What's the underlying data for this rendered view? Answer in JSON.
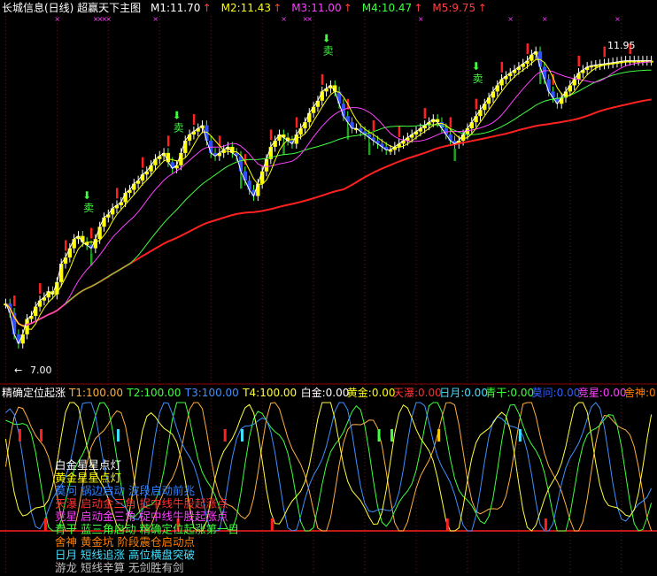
{
  "header": {
    "title": "长城信息(日线) 超赢天下主图",
    "title_color": "#ffffff",
    "indicators": [
      {
        "label": "M1:11.70",
        "color": "#ffffff"
      },
      {
        "label": "M2:11.43",
        "color": "#ffff00"
      },
      {
        "label": "M3:11.00",
        "color": "#ff40ff"
      },
      {
        "label": "M4:10.47",
        "color": "#40ff40"
      },
      {
        "label": "M5:9.75",
        "color": "#ff4040"
      }
    ]
  },
  "sub_header": {
    "title": "精确定位起涨",
    "items": [
      {
        "label": "T1:100.00",
        "color": "#ffb040"
      },
      {
        "label": "T2:100.00",
        "color": "#40ff40"
      },
      {
        "label": "T3:100.00",
        "color": "#4090ff"
      },
      {
        "label": "T4:100.00",
        "color": "#ffff40"
      },
      {
        "label": "白金:0.00",
        "color": "#ffffff"
      },
      {
        "label": "黄金:0.00",
        "color": "#ffff00"
      },
      {
        "label": "天瀑:0.00",
        "color": "#ff3030"
      },
      {
        "label": "日月:0.00",
        "color": "#40e0ff"
      },
      {
        "label": "青干:0.00",
        "color": "#40ff40"
      },
      {
        "label": "莫问:0.00",
        "color": "#3060ff"
      },
      {
        "label": "竞星:0.00",
        "color": "#ff40ff"
      },
      {
        "label": "舍神:0",
        "color": "#ff8000"
      }
    ]
  },
  "legend_lines": [
    {
      "text": "白金星星点灯",
      "color": "#ffffff"
    },
    {
      "text": "黄金星星点灯",
      "color": "#ffff00"
    },
    {
      "text": "莫问  锅边启动  波段启动前兆",
      "color": "#3080ff"
    },
    {
      "text": "天瀑  启动金三角  捉中线牛股起涨点",
      "color": "#ff3030"
    },
    {
      "text": "竞星  启动金三角  捉中线牛股起涨点",
      "color": "#ff40ff"
    },
    {
      "text": "青干  蓝三角启动  精确定位起涨第一目",
      "color": "#40ff40"
    },
    {
      "text": "舍神  黄金坑  阶段震仓启动点",
      "color": "#ff8000"
    },
    {
      "text": "日月  短线追涨  高位横盘突破",
      "color": "#40e0ff"
    },
    {
      "text": "游龙  短线辛算  无剑胜有剑",
      "color": "#c0c0c0"
    }
  ],
  "annotations": {
    "high_label": "11.95",
    "low_label": "7.00",
    "sell_label": "卖",
    "sell_color": "#40ff40",
    "arrow_color": "#ffffff"
  },
  "chart_data": [
    {
      "type": "line",
      "title": "长城信息(日线) 超赢天下主图",
      "ylim": [
        6.6,
        12.5
      ],
      "price_high": 11.95,
      "price_low": 7.0,
      "x": [
        0,
        1,
        2,
        3,
        4,
        5,
        6,
        7,
        8,
        9,
        10,
        11,
        12,
        13,
        14,
        15,
        16,
        17,
        18,
        19,
        20,
        21,
        22,
        23,
        24,
        25,
        26,
        27,
        28,
        29,
        30,
        31,
        32,
        33,
        34,
        35,
        36,
        37,
        38,
        39,
        40,
        41,
        42,
        43,
        44,
        45,
        46,
        47,
        48,
        49,
        50,
        51,
        52,
        53,
        54,
        55,
        56,
        57,
        58,
        59,
        60,
        61,
        62,
        63,
        64,
        65,
        66,
        67,
        68,
        69,
        70,
        71,
        72,
        73,
        74,
        75,
        76,
        77,
        78,
        79,
        80,
        81,
        82,
        83,
        84,
        85,
        86,
        87,
        88,
        89,
        90,
        91,
        92,
        93,
        94,
        95,
        96,
        97,
        98,
        99,
        100,
        101,
        102,
        103,
        104,
        105,
        106,
        107,
        108,
        109,
        110,
        111,
        112,
        113,
        114,
        115,
        116,
        117,
        118,
        119,
        120,
        121,
        122,
        123,
        124,
        125,
        126,
        127,
        128,
        129,
        130,
        131,
        132,
        133,
        134,
        135,
        136,
        137,
        138,
        139,
        140,
        141,
        142,
        143,
        144,
        145,
        146,
        147,
        148,
        149
      ],
      "close": [
        7.85,
        7.7,
        7.35,
        7.2,
        7.35,
        7.6,
        7.65,
        7.8,
        7.9,
        7.95,
        8.05,
        8.0,
        8.2,
        8.5,
        8.6,
        8.75,
        8.9,
        8.95,
        8.85,
        8.8,
        8.75,
        8.9,
        9.1,
        9.25,
        9.3,
        9.4,
        9.45,
        9.5,
        9.65,
        9.7,
        9.8,
        9.85,
        9.95,
        10.0,
        10.1,
        10.2,
        10.25,
        10.3,
        10.15,
        10.05,
        10.1,
        10.3,
        10.5,
        10.6,
        10.65,
        10.7,
        10.75,
        10.5,
        10.3,
        10.25,
        10.3,
        10.35,
        10.4,
        10.3,
        10.25,
        10.0,
        9.85,
        9.7,
        9.6,
        9.8,
        10.0,
        10.2,
        10.4,
        10.5,
        10.6,
        10.55,
        10.5,
        10.45,
        10.6,
        10.7,
        10.8,
        10.95,
        11.05,
        11.15,
        11.3,
        11.35,
        11.4,
        11.3,
        11.1,
        10.9,
        10.8,
        10.7,
        10.7,
        10.65,
        10.6,
        10.55,
        10.5,
        10.45,
        10.4,
        10.35,
        10.35,
        10.4,
        10.45,
        10.5,
        10.55,
        10.6,
        10.65,
        10.7,
        10.75,
        10.8,
        10.85,
        10.8,
        10.7,
        10.6,
        10.5,
        10.45,
        10.5,
        10.6,
        10.7,
        10.8,
        10.9,
        11.0,
        11.1,
        11.2,
        11.3,
        11.4,
        11.5,
        11.55,
        11.6,
        11.65,
        11.7,
        11.75,
        11.8,
        11.9,
        11.95,
        11.7,
        11.5,
        11.3,
        11.2,
        11.1,
        11.2,
        11.3,
        11.4,
        11.5,
        11.6,
        11.65,
        11.7,
        11.72,
        11.73,
        11.74,
        11.75,
        11.76,
        11.77,
        11.78,
        11.79,
        11.8,
        11.8,
        11.8,
        11.8,
        11.8,
        11.8,
        11.8
      ],
      "series": [
        {
          "name": "M1",
          "color": "#ffffff",
          "values": "close"
        },
        {
          "name": "M2",
          "color": "#ffff00",
          "values": "ma_short"
        },
        {
          "name": "M3",
          "color": "#ff40ff",
          "values": "ma_mid"
        },
        {
          "name": "M4",
          "color": "#40ff40",
          "values": "ma_long"
        },
        {
          "name": "M5",
          "color": "#ff4040",
          "values": "ma_xlong"
        }
      ],
      "last_values": {
        "M1": 11.7,
        "M2": 11.43,
        "M3": 11.0,
        "M4": 10.47,
        "M5": 9.75
      }
    },
    {
      "type": "line",
      "title": "精确定位起涨",
      "ylim": [
        0,
        100
      ],
      "series": [
        {
          "name": "T1",
          "color": "#ffb040"
        },
        {
          "name": "T2",
          "color": "#40ff40"
        },
        {
          "name": "T3",
          "color": "#4090ff"
        },
        {
          "name": "T4",
          "color": "#ffff40"
        }
      ]
    }
  ]
}
